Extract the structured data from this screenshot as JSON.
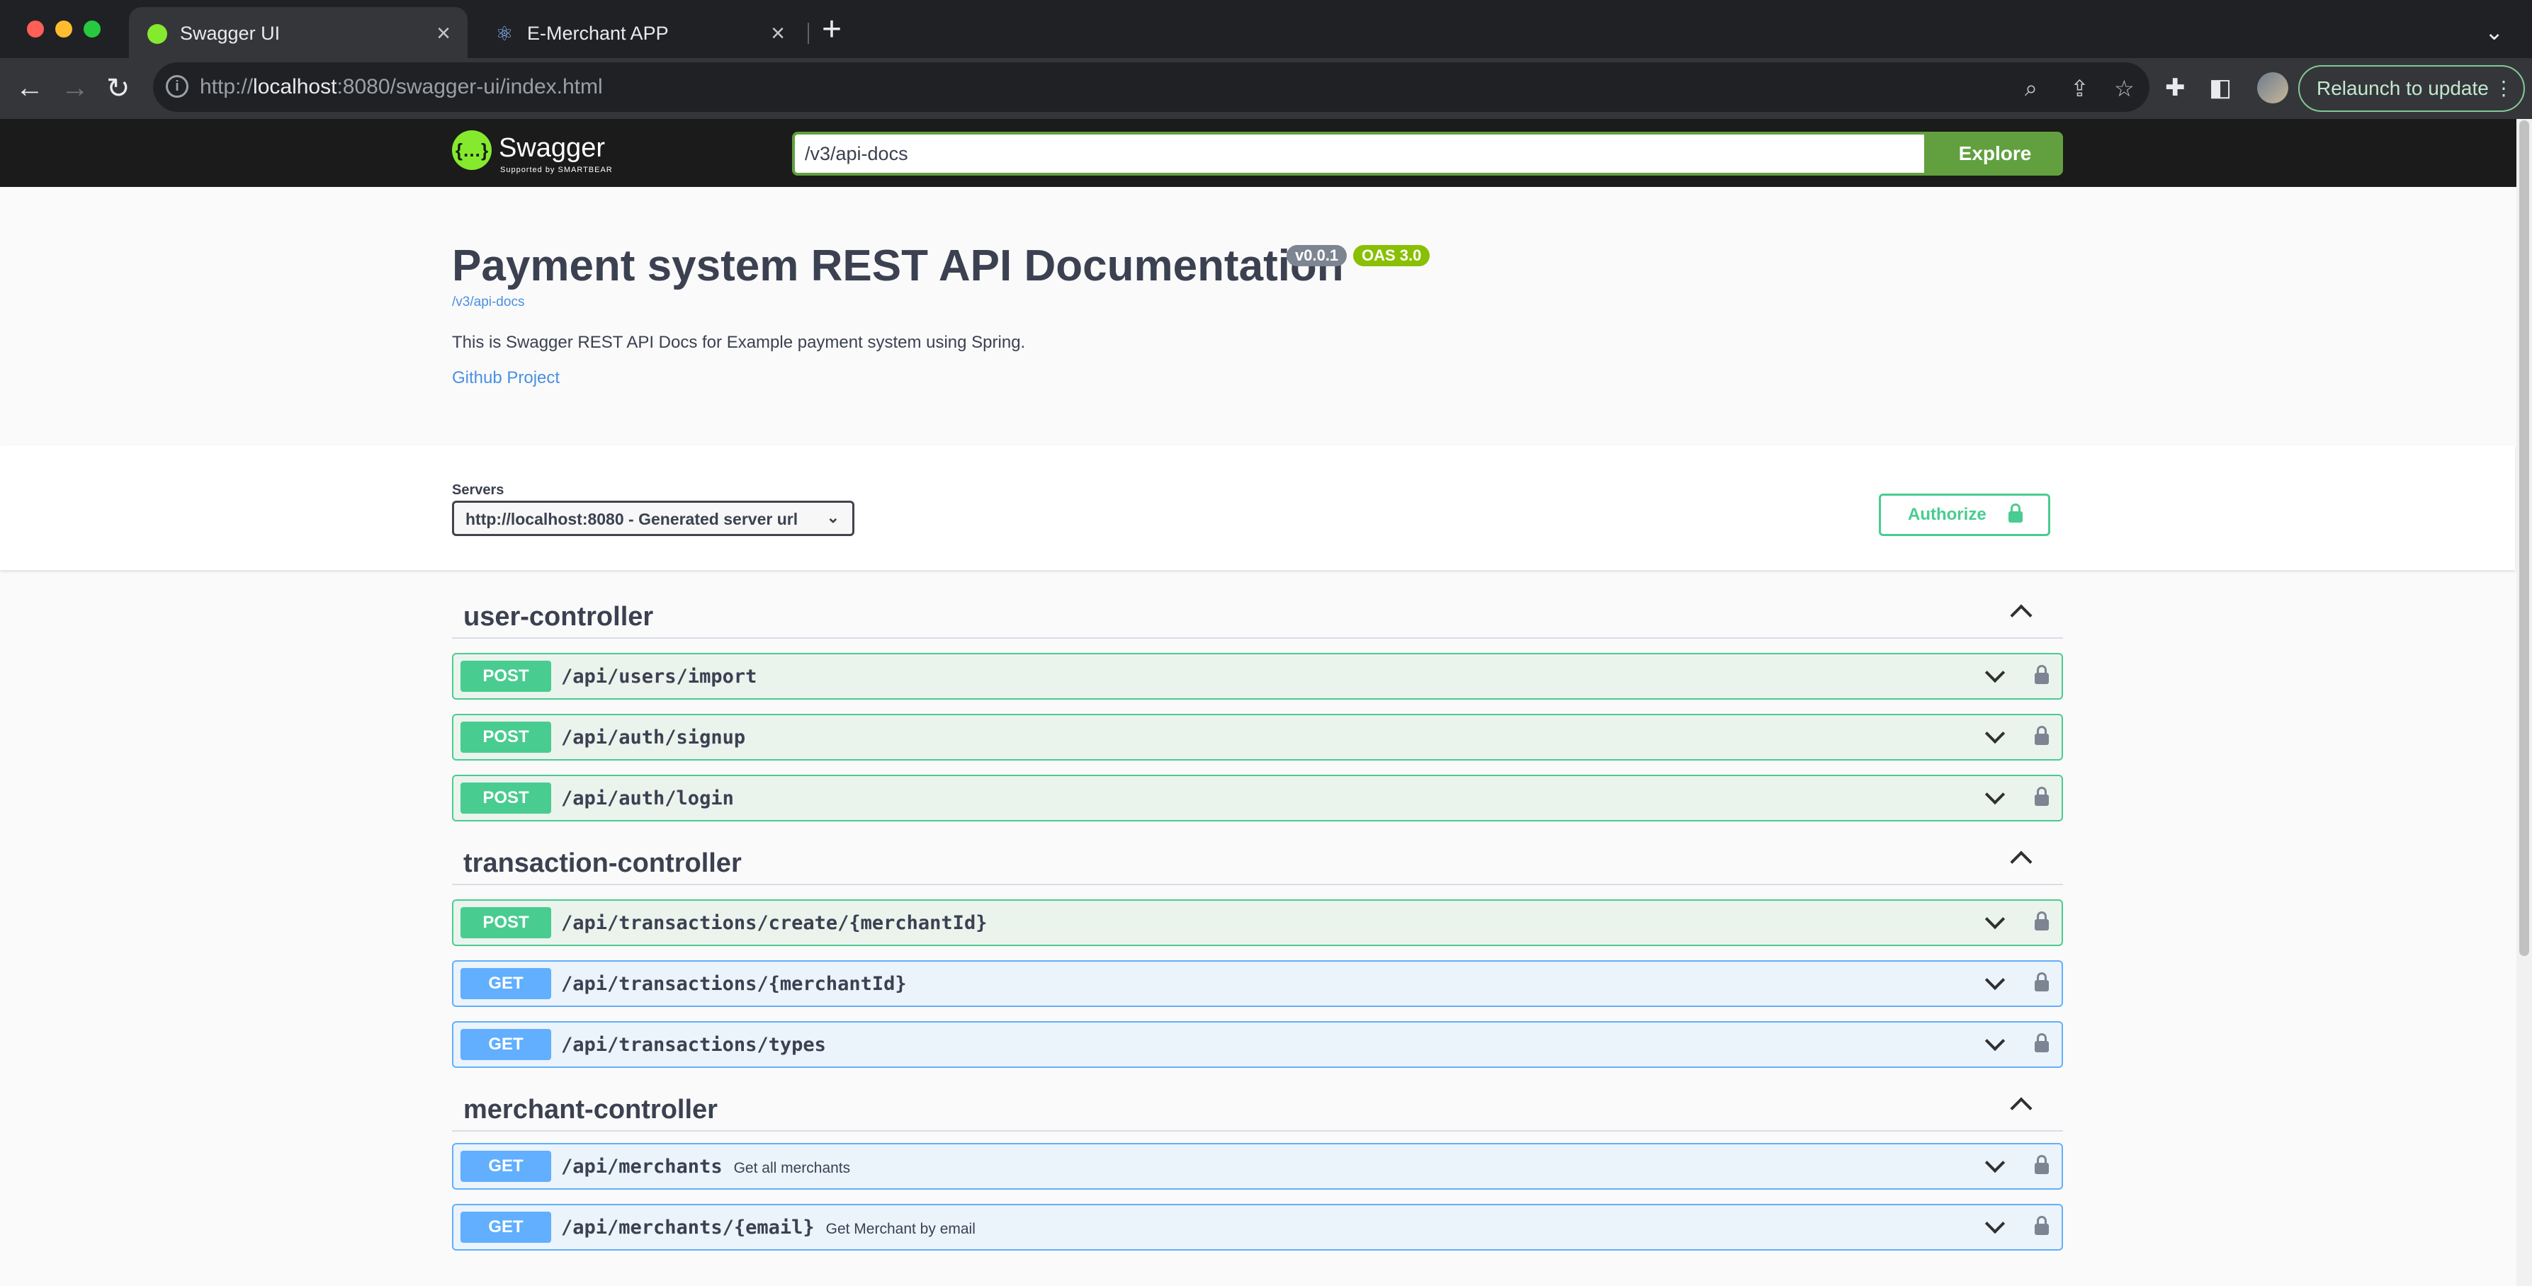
{
  "browser": {
    "tabs": [
      {
        "title": "Swagger UI",
        "active": true
      },
      {
        "title": "E-Merchant APP",
        "active": false
      }
    ],
    "url_prefix": "http://",
    "url_host": "localhost",
    "url_rest": ":8080/swagger-ui/index.html",
    "relaunch_label": "Relaunch to update"
  },
  "topbar": {
    "logo_name": "Swagger",
    "logo_sub": "Supported by SMARTBEAR",
    "definition_url": "/v3/api-docs",
    "explore_label": "Explore"
  },
  "info": {
    "title": "Payment system REST API Documentation",
    "version_badge": "v0.0.1",
    "oas_badge": "OAS 3.0",
    "spec_link": "/v3/api-docs",
    "description": "This is Swagger REST API Docs for Example payment system using Spring.",
    "github_link": "Github Project"
  },
  "servers": {
    "label": "Servers",
    "selected": "http://localhost:8080 - Generated server url",
    "authorize_label": "Authorize"
  },
  "controllers": [
    {
      "name": "user-controller",
      "operations": [
        {
          "method": "POST",
          "path": "/api/users/import",
          "summary": ""
        },
        {
          "method": "POST",
          "path": "/api/auth/signup",
          "summary": ""
        },
        {
          "method": "POST",
          "path": "/api/auth/login",
          "summary": ""
        }
      ]
    },
    {
      "name": "transaction-controller",
      "operations": [
        {
          "method": "POST",
          "path": "/api/transactions/create/{merchantId}",
          "summary": ""
        },
        {
          "method": "GET",
          "path": "/api/transactions/{merchantId}",
          "summary": ""
        },
        {
          "method": "GET",
          "path": "/api/transactions/types",
          "summary": ""
        }
      ]
    },
    {
      "name": "merchant-controller",
      "operations": [
        {
          "method": "GET",
          "path": "/api/merchants",
          "summary": "Get all merchants"
        },
        {
          "method": "GET",
          "path": "/api/merchants/{email}",
          "summary": "Get Merchant by email"
        }
      ]
    }
  ],
  "colors": {
    "post": "#49cc90",
    "get": "#61affe",
    "swagger_green": "#62a03f",
    "topbar_bg": "#1b1b1b"
  }
}
